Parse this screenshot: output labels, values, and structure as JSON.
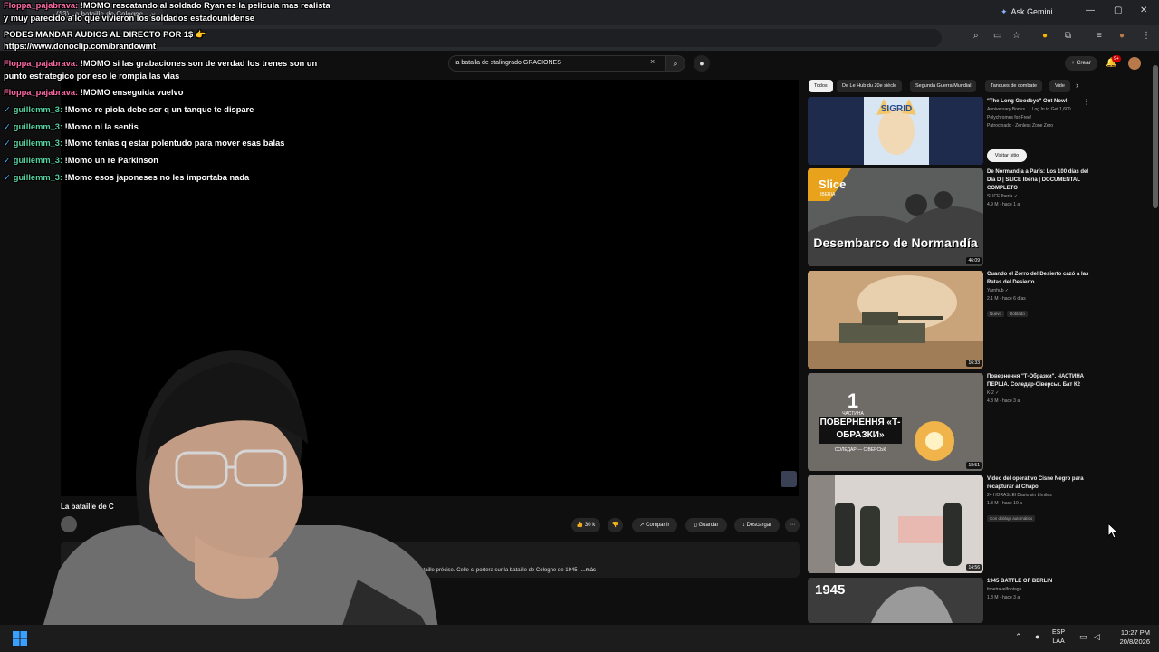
{
  "browser": {
    "tab_title": "(13) La bataille de Cologne - ...",
    "tab_close": "×",
    "ask_gemini": "Ask Gemini",
    "window_controls": [
      "—",
      "▢",
      "✕"
    ]
  },
  "youtube": {
    "search": {
      "value": "la batalla de stalingrado GRACIONES",
      "clear": "×",
      "search_icon": "⌕",
      "mic_icon": "🎙"
    },
    "create_label": "+ Crear",
    "notifications_count": "9+",
    "player": {
      "title": "La bataille de C",
      "likes": "30 k",
      "share": "Compartir",
      "save": "Guardar",
      "download": "Descargar",
      "more": "⋯",
      "description": "...e de combat d'une bataille précise. Celle-ci portera sur la bataille de Cologne de 1945",
      "description_more": "...más"
    },
    "chips": [
      {
        "label": "Todos",
        "active": true
      },
      {
        "label": "De Le Hub du 20e siècle",
        "active": false
      },
      {
        "label": "Segunda Guerra Mundial",
        "active": false
      },
      {
        "label": "Tanques de combate",
        "active": false
      },
      {
        "label": "Vide",
        "active": false
      }
    ],
    "sidebar": [
      {
        "title": "\"The Long Goodbye\" Out Now!",
        "lines": [
          "Anniversary Bonus → Log In to Get 1,600 Polychromes for Free!",
          "Patrocinado · Zenless Zone Zero"
        ],
        "thumb_text": "SIGRID",
        "button": "Visitar sitio"
      },
      {
        "title": "De Normandía a París: Los 100 días del Día D | SLICE Iberia | DOCUMENTAL COMPLETO",
        "lines": [
          "SLICE Iberia ✓",
          "4.9 M · hace 1 a"
        ],
        "thumb_text": "Desembarco de Normandía",
        "thumb_brand": "Slice",
        "thumb_brand_sub": "IBERIA",
        "duration": "46:09"
      },
      {
        "title": "Cuando el Zorro del Desierto cazó a las Ratas del Desierto",
        "lines": [
          "Yarnhub ✓",
          "2.1 M · hace 6 días"
        ],
        "badges": [
          "Nuevo",
          "Doblado"
        ],
        "duration": "16:33"
      },
      {
        "title": "Повернення \"Т-Образки\". ЧАСТИНА ПЕРША. Соледар-Сіверськ. Бат К2",
        "lines": [
          "K-2 ✓",
          "4.8 M · hace 3 a"
        ],
        "thumb_text": "ПОВЕРНЕННЯ «Т-ОБРАЗКИ»",
        "thumb_num": "1",
        "thumb_num_label": "ЧАСТИНА",
        "thumb_sub": "СОЛЕДАР — СІВЕРСЬК",
        "duration": "18:51"
      },
      {
        "title": "Video del operativo Cisne Negro para recapturar al Chapo",
        "lines": [
          "24 HORAS. El Diario sin Límites",
          "1.8 M · hace 10 a"
        ],
        "badges": [
          "Con doblaje automático"
        ],
        "duration": "14:56"
      },
      {
        "title": "1945 BATTLE OF BERLIN",
        "lines": [
          "timetravelfootage",
          "1.8 M · hace 3 a"
        ],
        "thumb_text": "1945"
      }
    ]
  },
  "chat": [
    {
      "user": "Floppa_pajabrava:",
      "msg": "!MOMO rescatando al soldado Ryan es la pelicula mas realista",
      "color": "pink"
    },
    {
      "user": "",
      "msg": "y muy parecido a lo que vivieron los soldados estadounidense",
      "color": "none"
    },
    {
      "user": "",
      "msg": "PODES MANDAR AUDIOS AL DIRECTO POR 1$ 👉",
      "color": "none"
    },
    {
      "user": "",
      "msg": "https://www.donoclip.com/brandowmt",
      "color": "none"
    },
    {
      "user": "Floppa_pajabrava:",
      "msg": "!MOMO si las grabaciones son de verdad los trenes son un",
      "color": "pink"
    },
    {
      "user": "",
      "msg": "punto estrategico por eso le rompia las vias",
      "color": "none"
    },
    {
      "user": "Floppa_pajabrava:",
      "msg": "!MOMO enseguida vuelvo",
      "color": "pink"
    },
    {
      "user": "guillemm_3:",
      "msg": "!Momo re piola debe ser q un tanque te dispare",
      "color": "green"
    },
    {
      "user": "guillemm_3:",
      "msg": "!Momo ni la sentis",
      "color": "green"
    },
    {
      "user": "guillemm_3:",
      "msg": "!Momo tenias q estar polentudo para mover esas balas",
      "color": "green"
    },
    {
      "user": "guillemm_3:",
      "msg": "!Momo un re Parkinson",
      "color": "green"
    },
    {
      "user": "guillemm_3:",
      "msg": "!Momo esos japoneses no les importaba nada",
      "color": "green"
    }
  ],
  "taskbar": {
    "lang_top": "ESP",
    "lang_bottom": "LAA",
    "time": "10:27 PM",
    "date": "20/8/2026"
  },
  "colors": {
    "background": "#0f0f0f",
    "chat_pink": "#ff6aa6",
    "chat_green": "#56d3a3",
    "accent_red": "#cc0000"
  }
}
